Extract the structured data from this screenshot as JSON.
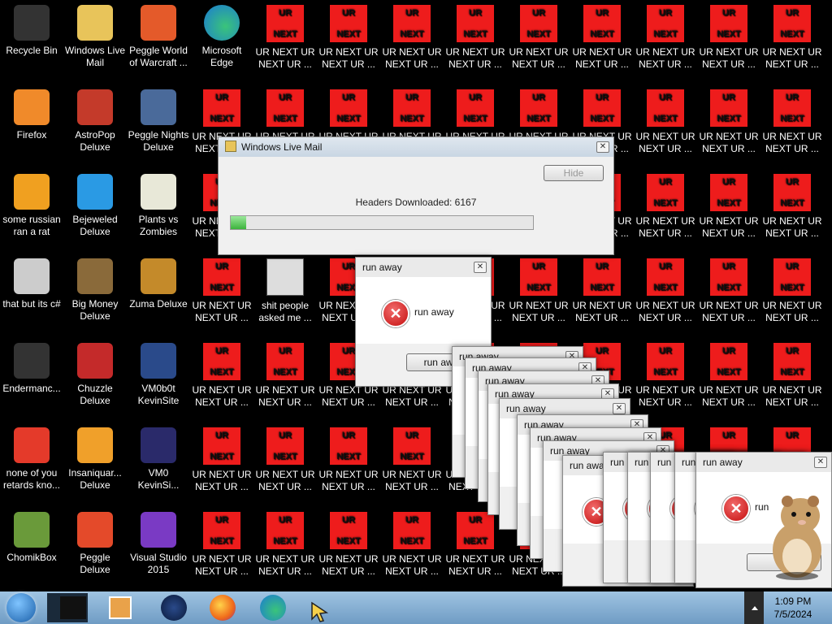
{
  "desktop": {
    "col1": [
      "Recycle Bin",
      "Firefox",
      "some russian ran a rat",
      "that but its c#",
      "Endermanc...",
      "none of you retards kno...",
      "ChomikBox"
    ],
    "col2": [
      "Windows Live Mail",
      "AstroPop Deluxe",
      "Bejeweled Deluxe",
      "Big Money Deluxe",
      "Chuzzle Deluxe",
      "Insaniquar... Deluxe",
      "Peggle Deluxe"
    ],
    "col3": [
      "Peggle World of Warcraft ...",
      "Peggle Nights Deluxe",
      "Plants vs Zombies",
      "Zuma Deluxe",
      "VM0b0t KevinSite",
      "VM0 KevinSi...",
      "Visual Studio 2015"
    ],
    "col4_row1": "Microsoft Edge",
    "shit_people": "shit people asked me ...",
    "ur_label": "UR NEXT UR NEXT UR ...",
    "ur_top": "UR",
    "ur_bottom": "NEXT"
  },
  "wlm_window": {
    "title": "Windows Live Mail",
    "hide_button": "Hide",
    "status": "Headers Downloaded: 6167",
    "progress": 0.05
  },
  "run_away": {
    "title": "run away",
    "message": "run away",
    "button": "run away",
    "message_trunc": "run",
    "button_trunc": "ru"
  },
  "taskbar": {
    "time": "1:09 PM",
    "date": "7/5/2024"
  },
  "colors": {
    "ur_red": "#ee1c1c",
    "taskbar": "#8ab3d6"
  }
}
